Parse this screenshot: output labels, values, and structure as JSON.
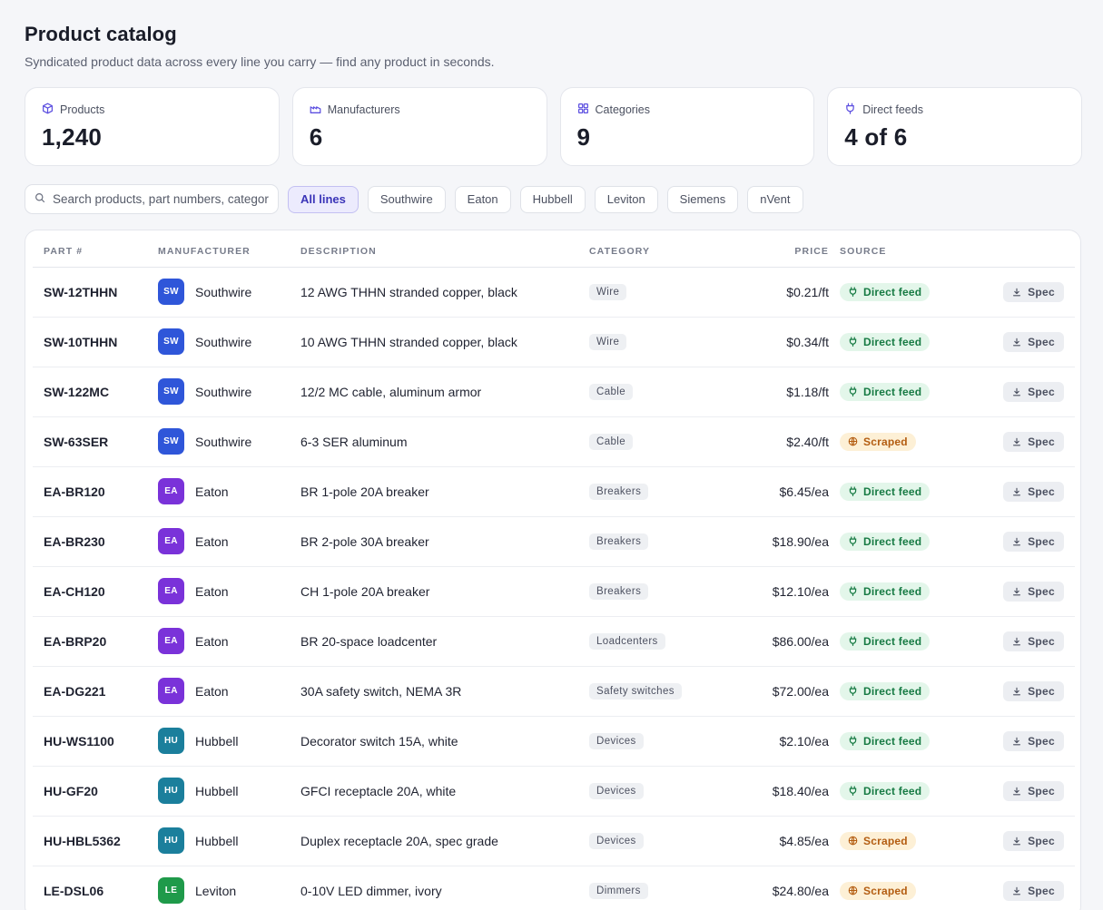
{
  "page": {
    "title": "Product catalog",
    "subtitle": "Syndicated product data across every line you carry — find any product in seconds."
  },
  "stats": [
    {
      "label": "Products",
      "value": "1,240",
      "icon": "box-icon"
    },
    {
      "label": "Manufacturers",
      "value": "6",
      "icon": "factory-icon"
    },
    {
      "label": "Categories",
      "value": "9",
      "icon": "grid-icon"
    },
    {
      "label": "Direct feeds",
      "value": "4 of 6",
      "icon": "plug-icon"
    }
  ],
  "search": {
    "placeholder": "Search products, part numbers, categories",
    "value": ""
  },
  "filters": [
    "All lines",
    "Southwire",
    "Eaton",
    "Hubbell",
    "Leviton",
    "Siemens",
    "nVent"
  ],
  "active_filter": "All lines",
  "table": {
    "headers": {
      "part": "PART #",
      "manufacturer": "MANUFACTURER",
      "description": "DESCRIPTION",
      "category": "CATEGORY",
      "price": "PRICE",
      "source": "SOURCE"
    },
    "spec_label": "Spec",
    "source_labels": {
      "direct": "Direct feed",
      "scraped": "Scraped"
    },
    "manufacturer_colors": {
      "SW": "#2f56d9",
      "EA": "#7a32d9",
      "HU": "#1b7f9c",
      "LE": "#1f9a4a"
    },
    "rows": [
      {
        "part": "SW-12THHN",
        "abbr": "SW",
        "manufacturer": "Southwire",
        "description": "12 AWG THHN stranded copper, black",
        "category": "Wire",
        "price": "$0.21/ft",
        "source": "direct"
      },
      {
        "part": "SW-10THHN",
        "abbr": "SW",
        "manufacturer": "Southwire",
        "description": "10 AWG THHN stranded copper, black",
        "category": "Wire",
        "price": "$0.34/ft",
        "source": "direct"
      },
      {
        "part": "SW-122MC",
        "abbr": "SW",
        "manufacturer": "Southwire",
        "description": "12/2 MC cable, aluminum armor",
        "category": "Cable",
        "price": "$1.18/ft",
        "source": "direct"
      },
      {
        "part": "SW-63SER",
        "abbr": "SW",
        "manufacturer": "Southwire",
        "description": "6-3 SER aluminum",
        "category": "Cable",
        "price": "$2.40/ft",
        "source": "scraped"
      },
      {
        "part": "EA-BR120",
        "abbr": "EA",
        "manufacturer": "Eaton",
        "description": "BR 1-pole 20A breaker",
        "category": "Breakers",
        "price": "$6.45/ea",
        "source": "direct"
      },
      {
        "part": "EA-BR230",
        "abbr": "EA",
        "manufacturer": "Eaton",
        "description": "BR 2-pole 30A breaker",
        "category": "Breakers",
        "price": "$18.90/ea",
        "source": "direct"
      },
      {
        "part": "EA-CH120",
        "abbr": "EA",
        "manufacturer": "Eaton",
        "description": "CH 1-pole 20A breaker",
        "category": "Breakers",
        "price": "$12.10/ea",
        "source": "direct"
      },
      {
        "part": "EA-BRP20",
        "abbr": "EA",
        "manufacturer": "Eaton",
        "description": "BR 20-space loadcenter",
        "category": "Loadcenters",
        "price": "$86.00/ea",
        "source": "direct"
      },
      {
        "part": "EA-DG221",
        "abbr": "EA",
        "manufacturer": "Eaton",
        "description": "30A safety switch, NEMA 3R",
        "category": "Safety switches",
        "price": "$72.00/ea",
        "source": "direct"
      },
      {
        "part": "HU-WS1100",
        "abbr": "HU",
        "manufacturer": "Hubbell",
        "description": "Decorator switch 15A, white",
        "category": "Devices",
        "price": "$2.10/ea",
        "source": "direct"
      },
      {
        "part": "HU-GF20",
        "abbr": "HU",
        "manufacturer": "Hubbell",
        "description": "GFCI receptacle 20A, white",
        "category": "Devices",
        "price": "$18.40/ea",
        "source": "direct"
      },
      {
        "part": "HU-HBL5362",
        "abbr": "HU",
        "manufacturer": "Hubbell",
        "description": "Duplex receptacle 20A, spec grade",
        "category": "Devices",
        "price": "$4.85/ea",
        "source": "scraped"
      },
      {
        "part": "LE-DSL06",
        "abbr": "LE",
        "manufacturer": "Leviton",
        "description": "0-10V LED dimmer, ivory",
        "category": "Dimmers",
        "price": "$24.80/ea",
        "source": "scraped"
      }
    ]
  }
}
